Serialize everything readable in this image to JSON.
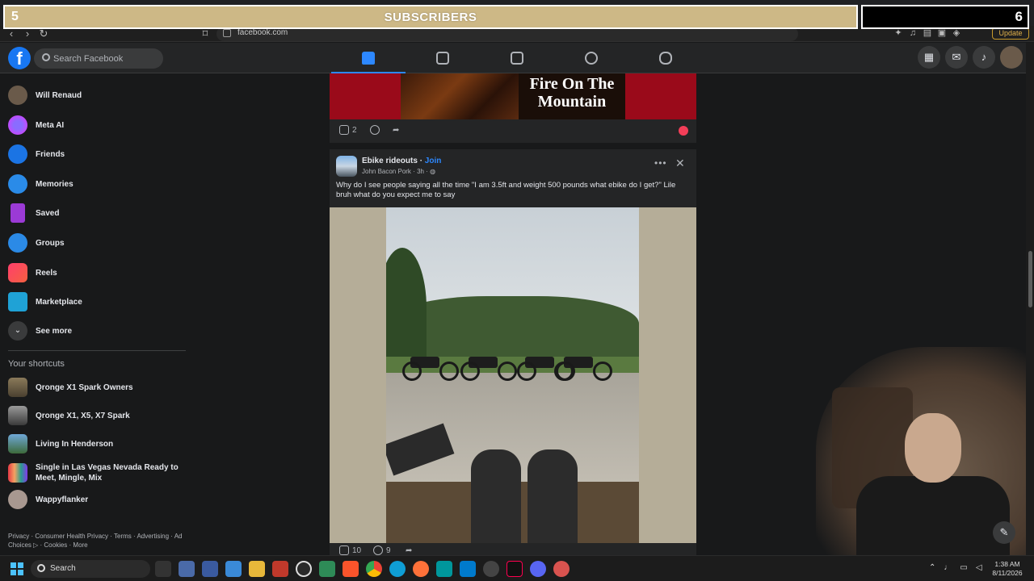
{
  "overlay": {
    "banner_title": "SUBSCRIBERS",
    "left_count": "5",
    "right_count": "6"
  },
  "browser": {
    "url": "facebook.com",
    "update_label": "Update"
  },
  "header": {
    "logo": "f",
    "search_placeholder": "Search Facebook",
    "nav_tabs": [
      "home",
      "video",
      "marketplace",
      "groups",
      "gaming"
    ],
    "active_tab": "home"
  },
  "sidebar": {
    "items": [
      {
        "label": "Will Renaud",
        "icon": "profile-avatar"
      },
      {
        "label": "Meta AI",
        "icon": "meta-ai-icon"
      },
      {
        "label": "Friends",
        "icon": "friends-icon"
      },
      {
        "label": "Memories",
        "icon": "memories-icon"
      },
      {
        "label": "Saved",
        "icon": "saved-icon"
      },
      {
        "label": "Groups",
        "icon": "groups-icon"
      },
      {
        "label": "Reels",
        "icon": "reels-icon"
      },
      {
        "label": "Marketplace",
        "icon": "marketplace-icon"
      },
      {
        "label": "See more",
        "icon": "chevron-down-icon"
      }
    ],
    "shortcuts_heading": "Your shortcuts",
    "shortcuts": [
      "Qronge X1 Spark Owners",
      "Qronge X1, X5, X7 Spark",
      "Living In Henderson",
      "Single in Las Vegas Nevada Ready to Meet, Mingle, Mix",
      "Wappyflanker"
    ],
    "footer": "Privacy · Consumer Health Privacy · Terms · Advertising · Ad Choices ▷ · Cookies · More"
  },
  "feed": {
    "prev_post": {
      "image_text": "Fire On The Mountain",
      "like_count": "2"
    },
    "post": {
      "group": "Ebike rideouts",
      "join": "Join",
      "author": "John Bacon Pork",
      "time": "3h",
      "text": "Why do I see people saying all the time \"I am 3.5ft and weight 500 pounds what ebike do I get?\" Lile bruh what do you expect me to say",
      "like_count": "10",
      "comment_count": "9"
    }
  },
  "taskbar": {
    "search_label": "Search",
    "time": "1:38 AM",
    "date": "8/11/2026"
  },
  "colors": {
    "fb_blue": "#1877f2",
    "active_blue": "#2d88ff",
    "banner": "#cdb886"
  }
}
